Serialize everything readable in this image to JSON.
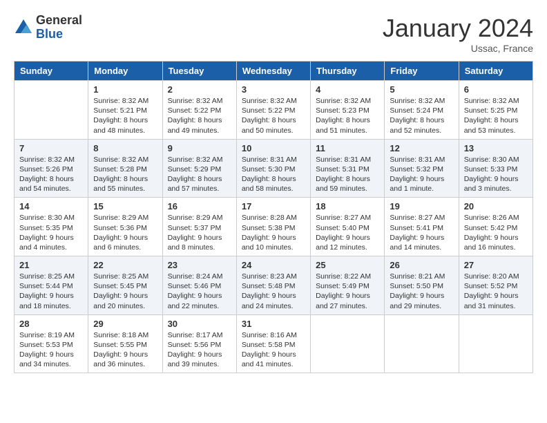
{
  "header": {
    "logo_general": "General",
    "logo_blue": "Blue",
    "month_title": "January 2024",
    "subtitle": "Ussac, France"
  },
  "weekdays": [
    "Sunday",
    "Monday",
    "Tuesday",
    "Wednesday",
    "Thursday",
    "Friday",
    "Saturday"
  ],
  "weeks": [
    [
      {
        "day": "",
        "info": ""
      },
      {
        "day": "1",
        "info": "Sunrise: 8:32 AM\nSunset: 5:21 PM\nDaylight: 8 hours\nand 48 minutes."
      },
      {
        "day": "2",
        "info": "Sunrise: 8:32 AM\nSunset: 5:22 PM\nDaylight: 8 hours\nand 49 minutes."
      },
      {
        "day": "3",
        "info": "Sunrise: 8:32 AM\nSunset: 5:22 PM\nDaylight: 8 hours\nand 50 minutes."
      },
      {
        "day": "4",
        "info": "Sunrise: 8:32 AM\nSunset: 5:23 PM\nDaylight: 8 hours\nand 51 minutes."
      },
      {
        "day": "5",
        "info": "Sunrise: 8:32 AM\nSunset: 5:24 PM\nDaylight: 8 hours\nand 52 minutes."
      },
      {
        "day": "6",
        "info": "Sunrise: 8:32 AM\nSunset: 5:25 PM\nDaylight: 8 hours\nand 53 minutes."
      }
    ],
    [
      {
        "day": "7",
        "info": "Sunrise: 8:32 AM\nSunset: 5:26 PM\nDaylight: 8 hours\nand 54 minutes."
      },
      {
        "day": "8",
        "info": "Sunrise: 8:32 AM\nSunset: 5:28 PM\nDaylight: 8 hours\nand 55 minutes."
      },
      {
        "day": "9",
        "info": "Sunrise: 8:32 AM\nSunset: 5:29 PM\nDaylight: 8 hours\nand 57 minutes."
      },
      {
        "day": "10",
        "info": "Sunrise: 8:31 AM\nSunset: 5:30 PM\nDaylight: 8 hours\nand 58 minutes."
      },
      {
        "day": "11",
        "info": "Sunrise: 8:31 AM\nSunset: 5:31 PM\nDaylight: 8 hours\nand 59 minutes."
      },
      {
        "day": "12",
        "info": "Sunrise: 8:31 AM\nSunset: 5:32 PM\nDaylight: 9 hours\nand 1 minute."
      },
      {
        "day": "13",
        "info": "Sunrise: 8:30 AM\nSunset: 5:33 PM\nDaylight: 9 hours\nand 3 minutes."
      }
    ],
    [
      {
        "day": "14",
        "info": "Sunrise: 8:30 AM\nSunset: 5:35 PM\nDaylight: 9 hours\nand 4 minutes."
      },
      {
        "day": "15",
        "info": "Sunrise: 8:29 AM\nSunset: 5:36 PM\nDaylight: 9 hours\nand 6 minutes."
      },
      {
        "day": "16",
        "info": "Sunrise: 8:29 AM\nSunset: 5:37 PM\nDaylight: 9 hours\nand 8 minutes."
      },
      {
        "day": "17",
        "info": "Sunrise: 8:28 AM\nSunset: 5:38 PM\nDaylight: 9 hours\nand 10 minutes."
      },
      {
        "day": "18",
        "info": "Sunrise: 8:27 AM\nSunset: 5:40 PM\nDaylight: 9 hours\nand 12 minutes."
      },
      {
        "day": "19",
        "info": "Sunrise: 8:27 AM\nSunset: 5:41 PM\nDaylight: 9 hours\nand 14 minutes."
      },
      {
        "day": "20",
        "info": "Sunrise: 8:26 AM\nSunset: 5:42 PM\nDaylight: 9 hours\nand 16 minutes."
      }
    ],
    [
      {
        "day": "21",
        "info": "Sunrise: 8:25 AM\nSunset: 5:44 PM\nDaylight: 9 hours\nand 18 minutes."
      },
      {
        "day": "22",
        "info": "Sunrise: 8:25 AM\nSunset: 5:45 PM\nDaylight: 9 hours\nand 20 minutes."
      },
      {
        "day": "23",
        "info": "Sunrise: 8:24 AM\nSunset: 5:46 PM\nDaylight: 9 hours\nand 22 minutes."
      },
      {
        "day": "24",
        "info": "Sunrise: 8:23 AM\nSunset: 5:48 PM\nDaylight: 9 hours\nand 24 minutes."
      },
      {
        "day": "25",
        "info": "Sunrise: 8:22 AM\nSunset: 5:49 PM\nDaylight: 9 hours\nand 27 minutes."
      },
      {
        "day": "26",
        "info": "Sunrise: 8:21 AM\nSunset: 5:50 PM\nDaylight: 9 hours\nand 29 minutes."
      },
      {
        "day": "27",
        "info": "Sunrise: 8:20 AM\nSunset: 5:52 PM\nDaylight: 9 hours\nand 31 minutes."
      }
    ],
    [
      {
        "day": "28",
        "info": "Sunrise: 8:19 AM\nSunset: 5:53 PM\nDaylight: 9 hours\nand 34 minutes."
      },
      {
        "day": "29",
        "info": "Sunrise: 8:18 AM\nSunset: 5:55 PM\nDaylight: 9 hours\nand 36 minutes."
      },
      {
        "day": "30",
        "info": "Sunrise: 8:17 AM\nSunset: 5:56 PM\nDaylight: 9 hours\nand 39 minutes."
      },
      {
        "day": "31",
        "info": "Sunrise: 8:16 AM\nSunset: 5:58 PM\nDaylight: 9 hours\nand 41 minutes."
      },
      {
        "day": "",
        "info": ""
      },
      {
        "day": "",
        "info": ""
      },
      {
        "day": "",
        "info": ""
      }
    ]
  ]
}
